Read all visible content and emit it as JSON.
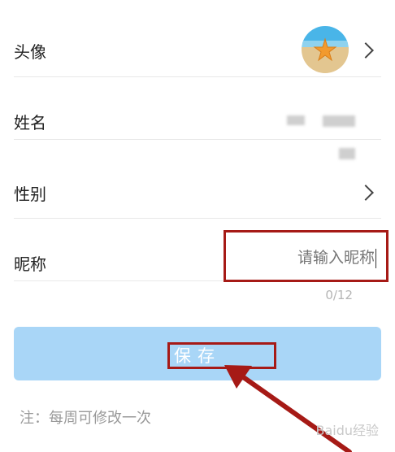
{
  "rows": {
    "avatar_label": "头像",
    "name_label": "姓名",
    "gender_label": "性别",
    "nickname_label": "昵称"
  },
  "nickname": {
    "placeholder": "请输入昵称",
    "counter": "0/12"
  },
  "save": {
    "label": "保存"
  },
  "note": "注：每周可修改一次",
  "watermark": "Baidu经验",
  "icons": {
    "chevron": "chevron-right-icon",
    "avatar": "starfish-beach-avatar"
  },
  "colors": {
    "button_bg": "#a9d6f7",
    "annotation_red": "#a61a16"
  }
}
